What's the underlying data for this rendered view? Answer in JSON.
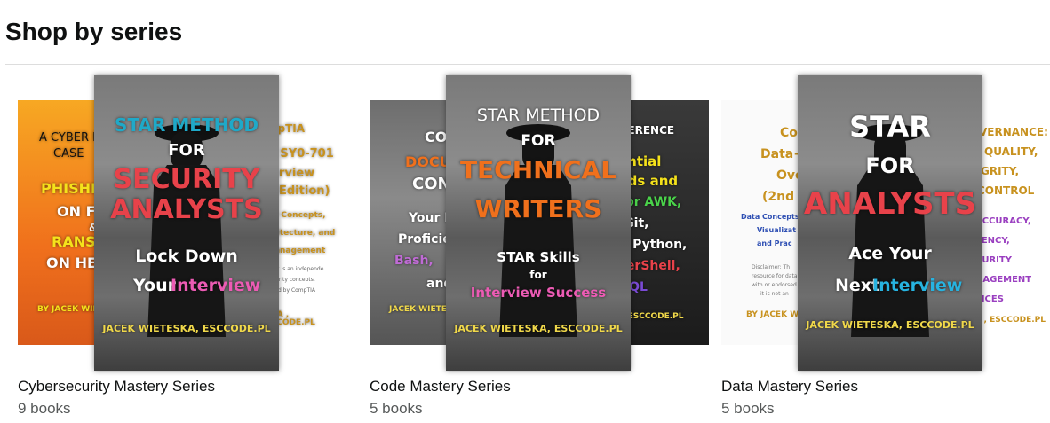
{
  "heading": "Shop by series",
  "series": [
    {
      "title": "Cybersecurity Mastery Series",
      "count": "9 books",
      "left_cover": {
        "lines": [
          "A CYBER F",
          "CASE",
          "PHISHING",
          "ON FIN",
          "&",
          "RANSOM",
          "ON HEAL",
          "BY JACEK WIETES"
        ]
      },
      "front_cover": {
        "lines": [
          "STAR METHOD",
          "FOR",
          "SECURITY",
          "ANALYSTS",
          "Lock Down",
          "Your",
          "Interview",
          "JACEK WIETESKA, ESCCODE.PL"
        ]
      },
      "right_cover": {
        "lines": [
          "mpTIA",
          "+ SY0-701",
          "rview",
          "Edition)",
          "ity Concepts,",
          "chitecture, and",
          "Management",
          "book is an independe",
          "security concepts,",
          "orsed by CompTIA",
          "ESKA , ESCCODE.PL"
        ]
      }
    },
    {
      "title": "Code Mastery Series",
      "count": "5 books",
      "left_cover": {
        "lines": [
          "CO",
          "DOCU",
          "CONT",
          "Your P",
          "Proficie",
          "Bash,",
          "and",
          "JACEK WIETES"
        ]
      },
      "front_cover": {
        "lines": [
          "STAR METHOD",
          "FOR",
          "TECHNICAL",
          "WRITERS",
          "STAR Skills",
          "for",
          "Interview Success",
          "JACEK WIETESKA, ESCCODE.PL"
        ]
      },
      "right_cover": {
        "lines": [
          "EFERENCE",
          "ential",
          "nds and",
          "for AWK,",
          ", Git,",
          "n, Python,",
          "werShell,",
          "SQL",
          "KA, ESCCODE.PL"
        ]
      }
    },
    {
      "title": "Data Mastery Series",
      "count": "5 books",
      "left_cover": {
        "lines": [
          "Co",
          "Data+",
          "Ove",
          "(2nd",
          "Data Concepts,",
          "Visualizat",
          "and Prac",
          "Disclaimer: Th",
          "resource for data",
          "with or endorsed b",
          "it is not an",
          "BY JACEK WIE"
        ]
      },
      "front_cover": {
        "lines": [
          "STAR",
          "FOR",
          "ANALYSTS",
          "Ace Your",
          "Next",
          "Interview",
          "JACEK WIETESKA, ESCCODE.PL"
        ]
      },
      "right_cover": {
        "lines": [
          "VERNANCE:",
          "QUALITY,",
          "GRITY,",
          "CONTROL",
          "ACCURACY,",
          "TENCY,",
          "CURITY",
          "NAGEMENT",
          "TICES",
          "SKA , ESCCODE.PL"
        ]
      }
    }
  ],
  "colors": {
    "text": "#0f1111",
    "secondary": "#565959",
    "divider": "#dddddd"
  }
}
